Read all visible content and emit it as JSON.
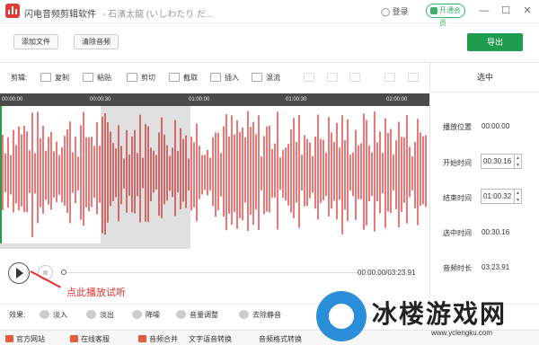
{
  "titlebar": {
    "app_name": "闪电音频剪辑软件",
    "separator_title": "- 石濱太龍 (いしわたり だ...",
    "login": "登录",
    "vip": "开通会员",
    "min": "—",
    "max": "☐",
    "close": "✕"
  },
  "toolbar1": {
    "add_file": "添加文件",
    "clear_audio": "清除音频",
    "export": "导出"
  },
  "edit": {
    "label": "剪辑:",
    "copy": "复制",
    "paste": "粘贴",
    "cut": "剪切",
    "crop": "截取",
    "insert": "插入",
    "mix": "混流"
  },
  "ruler": [
    "00:00:00",
    "00:00:30",
    "01:00:00",
    "01:00:30",
    "02:00:00"
  ],
  "selection_panel": {
    "title": "选中",
    "play_pos_label": "播放位置",
    "play_pos": "00:00.00",
    "start_label": "开始时间",
    "start": "00:30.16",
    "end_label": "结束时间",
    "end": "01:00.32",
    "selected_label": "选中时间",
    "selected": "00:30.16",
    "duration_label": "音频时长",
    "duration": "03:23.91"
  },
  "player": {
    "time": "00:00.00/03:23.91",
    "annotation": "点此播放试听"
  },
  "effects": {
    "label": "效果:",
    "fade_in": "淡入",
    "fade_out": "淡出",
    "denoise": "降噪",
    "volume": "音量调整",
    "silence": "去除静音"
  },
  "footer": {
    "website": "官方网站",
    "support": "在线客服",
    "merge": "音频合并",
    "tts": "文字语音转换",
    "format": "音频格式转换"
  },
  "watermark": {
    "text": "冰楼游戏网",
    "url": "www.yclengku.com"
  },
  "colors": {
    "wave": "#e03030",
    "accent": "#1f9d4e"
  }
}
